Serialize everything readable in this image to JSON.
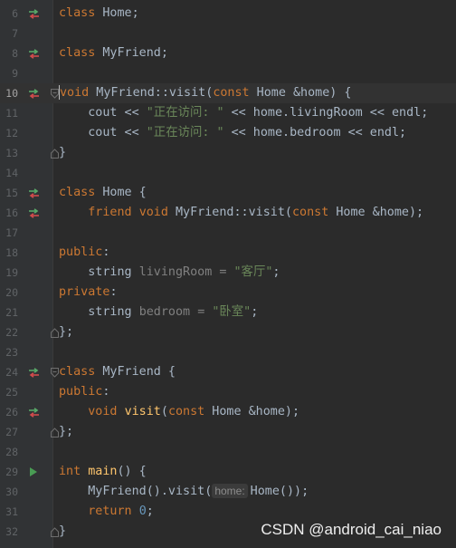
{
  "editor": {
    "lines": [
      {
        "num": "6",
        "text": "class Home;"
      },
      {
        "num": "7",
        "text": ""
      },
      {
        "num": "8",
        "text": "class MyFriend;"
      },
      {
        "num": "9",
        "text": ""
      },
      {
        "num": "10",
        "text": "void MyFriend::visit(const Home &home) {"
      },
      {
        "num": "11",
        "text": "    cout << \"正在访问: \" << home.livingRoom << endl;"
      },
      {
        "num": "12",
        "text": "    cout << \"正在访问: \" << home.bedroom << endl;"
      },
      {
        "num": "13",
        "text": "}"
      },
      {
        "num": "14",
        "text": ""
      },
      {
        "num": "15",
        "text": "class Home {"
      },
      {
        "num": "16",
        "text": "    friend void MyFriend::visit(const Home &home);"
      },
      {
        "num": "17",
        "text": ""
      },
      {
        "num": "18",
        "text": "public:"
      },
      {
        "num": "19",
        "text": "    string livingRoom = \"客厅\";"
      },
      {
        "num": "20",
        "text": "private:"
      },
      {
        "num": "21",
        "text": "    string bedroom = \"卧室\";"
      },
      {
        "num": "22",
        "text": "};"
      },
      {
        "num": "23",
        "text": ""
      },
      {
        "num": "24",
        "text": "class MyFriend {"
      },
      {
        "num": "25",
        "text": "public:"
      },
      {
        "num": "26",
        "text": "    void visit(const Home &home);"
      },
      {
        "num": "27",
        "text": "};"
      },
      {
        "num": "28",
        "text": ""
      },
      {
        "num": "29",
        "text": "int main() {"
      },
      {
        "num": "30",
        "text": "    MyFriend().visit( home: Home());"
      },
      {
        "num": "31",
        "text": "    return 0;"
      },
      {
        "num": "32",
        "text": "}"
      }
    ],
    "current_line": "10",
    "param_hint": "home:"
  },
  "colors": {
    "background": "#2b2b2b",
    "gutter": "#313335",
    "keyword": "#cc7832",
    "type": "#b5b6e3",
    "function": "#ffc66d",
    "string": "#6a8759",
    "number": "#6897bb",
    "plain": "#a9b7c6",
    "unused": "#808080",
    "gutter_arrow_red": "#d04c4c",
    "gutter_arrow_green": "#59a869",
    "run_icon": "#499c54"
  },
  "gutter_icons": {
    "6": "implementation-arrows-icon",
    "8": "implementation-arrows-icon",
    "10": "implementation-arrows-icon",
    "15": "implementation-arrows-icon",
    "16": "implementation-arrows-icon",
    "24": "implementation-arrows-icon",
    "26": "implementation-arrows-icon",
    "29": "run-icon"
  },
  "watermark": "CSDN @android_cai_niao"
}
